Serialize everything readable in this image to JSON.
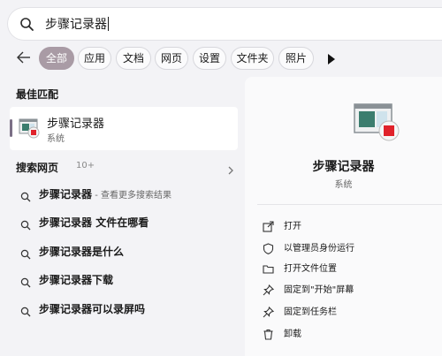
{
  "search": {
    "query": "步骤记录器"
  },
  "tabs": [
    {
      "label": "全部",
      "active": true
    },
    {
      "label": "应用"
    },
    {
      "label": "文档"
    },
    {
      "label": "网页"
    },
    {
      "label": "设置"
    },
    {
      "label": "文件夹"
    },
    {
      "label": "照片"
    }
  ],
  "best_match": {
    "section_title": "最佳匹配",
    "name": "步骤记录器",
    "category": "系统"
  },
  "web": {
    "section_title": "搜索网页",
    "count": "10+",
    "suggestions": [
      {
        "bold": "步骤记录器",
        "hint": " - 查看更多搜索结果",
        "rest": ""
      },
      {
        "bold": "步骤记录器",
        "hint": "",
        "rest": " 文件在哪看"
      },
      {
        "bold": "步骤记录器",
        "hint": "",
        "rest": "是什么"
      },
      {
        "bold": "步骤记录器",
        "hint": "",
        "rest": "下载"
      },
      {
        "bold": "步骤记录器",
        "hint": "",
        "rest": "可以录屏吗"
      }
    ]
  },
  "detail": {
    "name": "步骤记录器",
    "category": "系统",
    "actions": [
      {
        "label": "打开",
        "icon": "open-icon"
      },
      {
        "label": "以管理员身份运行",
        "icon": "shield-icon"
      },
      {
        "label": "打开文件位置",
        "icon": "folder-icon"
      },
      {
        "label": "固定到\"开始\"屏幕",
        "icon": "pin-icon"
      },
      {
        "label": "固定到任务栏",
        "icon": "pin-icon"
      },
      {
        "label": "卸载",
        "icon": "trash-icon"
      }
    ]
  },
  "colors": {
    "accent": "#a99ba5",
    "selection_bar": "#7b6f86",
    "background": "#f3f3f6"
  }
}
